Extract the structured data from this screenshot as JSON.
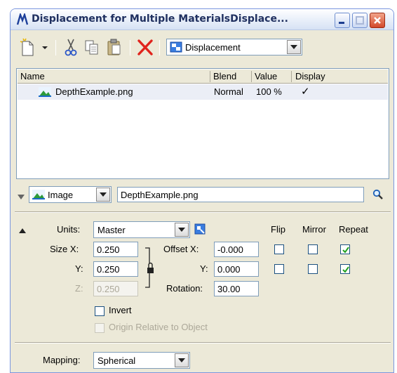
{
  "window": {
    "title": "Displacement for Multiple MaterialsDisplace..."
  },
  "toolbar": {
    "map_type": "Displacement"
  },
  "layers": {
    "columns": [
      "Name",
      "Blend",
      "Value",
      "Display"
    ],
    "rows": [
      {
        "name": "DepthExample.png",
        "blend": "Normal",
        "value": "100 %",
        "display": "✓"
      }
    ]
  },
  "image_panel": {
    "source_type": "Image",
    "filename": "DepthExample.png"
  },
  "settings": {
    "units_label": "Units:",
    "units_value": "Master",
    "flip_label": "Flip",
    "mirror_label": "Mirror",
    "repeat_label": "Repeat",
    "size_x_label": "Size X:",
    "size_x": "0.250",
    "size_y_label": "Y:",
    "size_y": "0.250",
    "size_z_label": "Z:",
    "size_z": "0.250",
    "offset_x_label": "Offset X:",
    "offset_x": "-0.000",
    "offset_y_label": "Y:",
    "offset_y": "0.000",
    "rotation_label": "Rotation:",
    "rotation": "30.00",
    "flip_x": false,
    "mirror_x": false,
    "repeat_x": true,
    "flip_y": false,
    "mirror_y": false,
    "repeat_y": true,
    "invert_label": "Invert",
    "invert": false,
    "origin_label": "Origin Relative to Object",
    "origin_relative": false
  },
  "mapping": {
    "label": "Mapping:",
    "value": "Spherical"
  }
}
